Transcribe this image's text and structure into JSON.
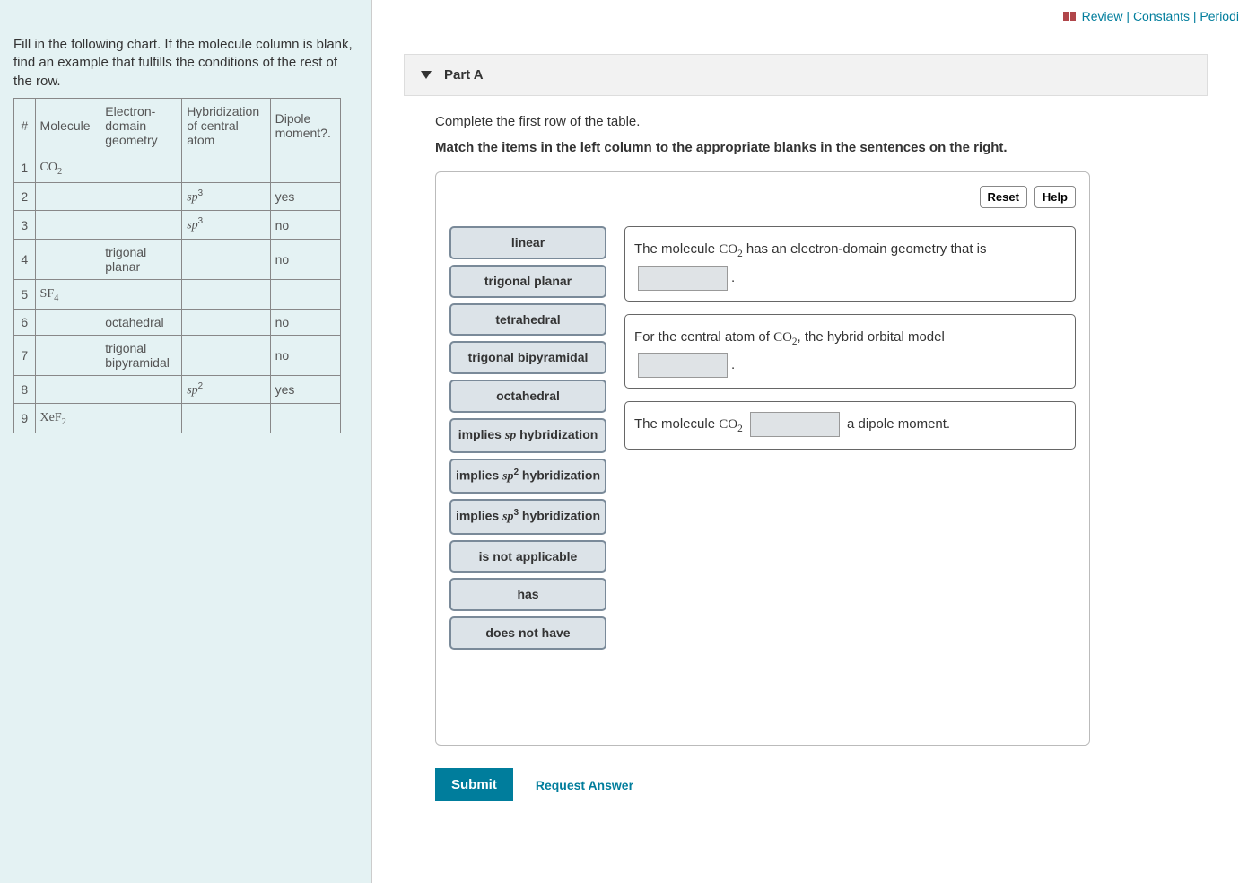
{
  "left": {
    "instructions": "Fill in the following chart. If the molecule column is blank, find an example that fulfills the conditions of the rest of the row.",
    "headers": {
      "num": "#",
      "molecule": "Molecule",
      "edg": "Electron-domain geometry",
      "hyb": "Hybridization of central atom",
      "dipole": "Dipole moment?."
    },
    "rows": [
      {
        "n": "1",
        "mol": "CO₂",
        "edg": "",
        "hyb": "",
        "dip": ""
      },
      {
        "n": "2",
        "mol": "",
        "edg": "",
        "hyb": "sp³",
        "dip": "yes"
      },
      {
        "n": "3",
        "mol": "",
        "edg": "",
        "hyb": "sp³",
        "dip": "no"
      },
      {
        "n": "4",
        "mol": "",
        "edg": "trigonal planar",
        "hyb": "",
        "dip": "no"
      },
      {
        "n": "5",
        "mol": "SF₄",
        "edg": "",
        "hyb": "",
        "dip": ""
      },
      {
        "n": "6",
        "mol": "",
        "edg": "octahedral",
        "hyb": "",
        "dip": "no"
      },
      {
        "n": "7",
        "mol": "",
        "edg": "trigonal bipyramidal",
        "hyb": "",
        "dip": "no"
      },
      {
        "n": "8",
        "mol": "",
        "edg": "",
        "hyb": "sp²",
        "dip": "yes"
      },
      {
        "n": "9",
        "mol": "XeF₂",
        "edg": "",
        "hyb": "",
        "dip": ""
      }
    ]
  },
  "toplinks": {
    "review": "Review",
    "constants": "Constants",
    "periodic": "Periodi"
  },
  "part": {
    "title": "Part A",
    "instr1": "Complete the first row of the table.",
    "instr2": "Match the items in the left column to the appropriate blanks in the sentences on the right.",
    "reset": "Reset",
    "help": "Help",
    "chips": [
      "linear",
      "trigonal planar",
      "tetrahedral",
      "trigonal bipyramidal",
      "octahedral",
      "implies sp hybridization",
      "implies sp² hybridization",
      "implies sp³ hybridization",
      "is not applicable",
      "has",
      "does not have"
    ],
    "sentence1_a": "The molecule ",
    "sentence1_mol": "CO₂",
    "sentence1_b": " has an electron-domain geometry that is",
    "sentence1_c": ".",
    "sentence2_a": "For the central atom of ",
    "sentence2_mol": "CO₂",
    "sentence2_b": ", the hybrid orbital model",
    "sentence2_c": ".",
    "sentence3_a": "The molecule ",
    "sentence3_mol": "CO₂",
    "sentence3_b": " a dipole moment."
  },
  "buttons": {
    "submit": "Submit",
    "request": "Request Answer"
  }
}
